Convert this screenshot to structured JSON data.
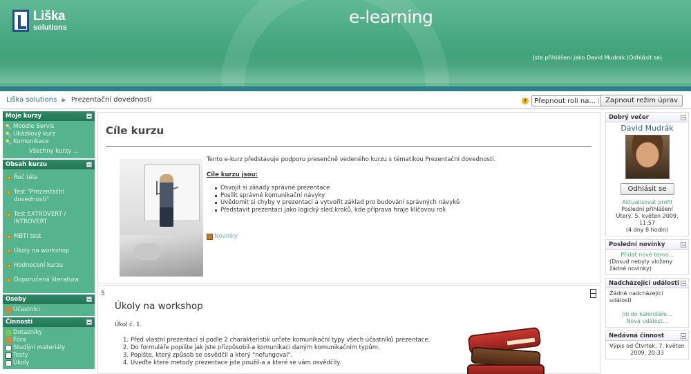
{
  "header": {
    "logo_name": "Liška",
    "logo_sub": "solutions",
    "site_title": "e-learning",
    "login_text": "Jste přihlášeni jako David Mudrák",
    "logout_link": "(Odhlásit se)"
  },
  "navbar": {
    "breadcrumb_home": "Liška solutions",
    "breadcrumb_sep": "▶",
    "breadcrumb_current": "Prezentační dovednosti",
    "help_icon": "?",
    "role_select": "Přepnout roli na...",
    "edit_button": "Zapnout režim úprav"
  },
  "left": {
    "my_courses": {
      "title": "Moje kurzy",
      "items": [
        "Moodle Servis",
        "Ukázkový kurz",
        "Komunikace"
      ],
      "all_link": "Všechny kurzy ..."
    },
    "content": {
      "title": "Obsah kurzu",
      "items": [
        "Řeč těla",
        "Test \"Prezentační dovednosti\"",
        "Test EXTROVERT / INTROVERT",
        "MBTI test",
        "Úkoly na workshop",
        "Hodnocení kurzu",
        "Doporučená literatura"
      ]
    },
    "people": {
      "title": "Osoby",
      "items": [
        "Účastníci"
      ]
    },
    "activities": {
      "title": "Činnosti",
      "items": [
        "Dotazníky",
        "Fóra",
        "Studijní materiály",
        "Testy",
        "Úkoly"
      ]
    }
  },
  "main": {
    "section0": {
      "title": "Cíle kurzu",
      "intro": "Tento e-kurz představuje podporu presenčně vedeného kurzu s tématikou Prezentační dovednosti.",
      "goals_heading": "Cíle kurzu jsou:",
      "goals": [
        "Osvojit si zásady správné prezentace",
        "Posílit správné komunikační návyky",
        "Uvědomit si chyby v prezentaci a vytvořit základ pro budování správných návyků",
        "Představit prezentaci jako logický sled kroků, kde příprava hraje klíčovou roli"
      ],
      "news_link": "Novinky"
    },
    "section5": {
      "number": "5",
      "title": "Úkoly na workshop",
      "task_label": "Úkol č. 1.",
      "tasks": [
        "Před vlastní prezentací si podle 2 charakteristik určete komunikační typy všech účastníků prezentace.",
        "Do formuláře popište jak jste přizpůsobil-a komunikaci daným komunikačním typům.",
        "Popište, který způsob se osvědčil a který \"nefungoval\".",
        "Uveďte které metody prezentace jste použil-a a které se vám osvědčily."
      ]
    }
  },
  "right": {
    "greeting": {
      "title": "Dobrý večer",
      "user_name": "David Mudrák",
      "logout_button": "Odhlásit se",
      "update_profile": "Aktualizovat profil",
      "last_login_label": "Poslední přihlášení",
      "last_login_date": "Úterý, 5. květen 2009, 11:57",
      "last_login_ago": "(4 dny 8 hodin)"
    },
    "news": {
      "title": "Poslední novinky",
      "add_link": "Přidat nové téma...",
      "empty_text": "(Dosud nebyly vloženy žádné novinky)"
    },
    "events": {
      "title": "Nadcházející události",
      "empty_text": "Žádné nadcházející události",
      "calendar_link": "Jdi do kalendáře...",
      "new_event_link": "Nová událost..."
    },
    "activity": {
      "title": "Nedávná činnost",
      "since_text": "Výpis od Čtvrtek, 7. květen 2009, 20:33"
    }
  },
  "colors": {
    "header_green": "#47a880",
    "sidebar_green": "#55b48d",
    "sidebar_header": "#237556",
    "link_blue": "#2a6496",
    "link_green": "#48a370"
  }
}
